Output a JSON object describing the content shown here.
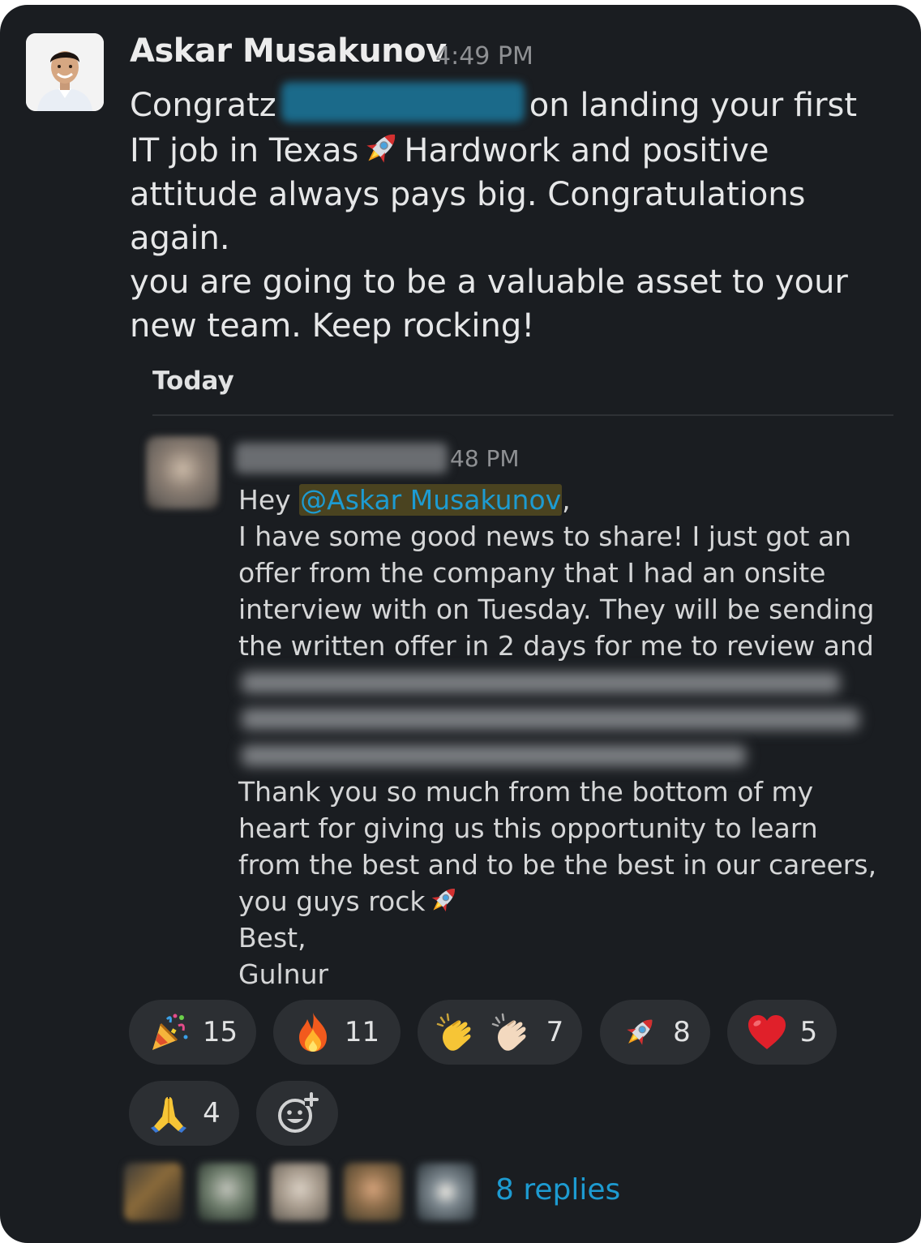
{
  "main_message": {
    "author": "Askar Musakunov",
    "time": "4:49 PM",
    "text_prefix": "Congratz",
    "text_suffix_line1": "on landing your first",
    "line2a": "IT job in Texas",
    "line2b": "Hardwork and positive",
    "line3": "attitude always pays big. Congratulations again.",
    "line4": "you are going to be a valuable asset to your",
    "line5": "new team. Keep rocking!"
  },
  "shared_message": {
    "date_label": "Today",
    "time": "48 PM",
    "greeting": "Hey ",
    "mention": "@Askar Musakunov",
    "comma": ",",
    "lines_before": [
      "I have some good news to share! I just got an",
      "offer from the company that I had an onsite",
      "interview with on Tuesday. They will be sending",
      "the written offer in 2 days for me to review and"
    ],
    "lines_after": [
      "Thank you so much from the bottom of my",
      "heart for giving us this opportunity to learn",
      "from the best and to be the best in our careers,"
    ],
    "rock_line": "you guys rock",
    "sign_off": "Best,",
    "signature": "Gulnur"
  },
  "reactions": [
    {
      "emoji": "party-popper",
      "count": "15"
    },
    {
      "emoji": "fire",
      "count": "11"
    },
    {
      "emoji": "clapping-hands",
      "count": "7"
    },
    {
      "emoji": "rocket",
      "count": "8"
    },
    {
      "emoji": "red-heart",
      "count": "5"
    },
    {
      "emoji": "folded-hands",
      "count": "4"
    }
  ],
  "add_reaction_icon": "add-reaction-icon",
  "replies": {
    "label": "8 replies"
  },
  "colors": {
    "background": "#1a1d21",
    "link": "#1d9bd1",
    "pill": "#2c2f33",
    "text": "#d1d2d3"
  }
}
